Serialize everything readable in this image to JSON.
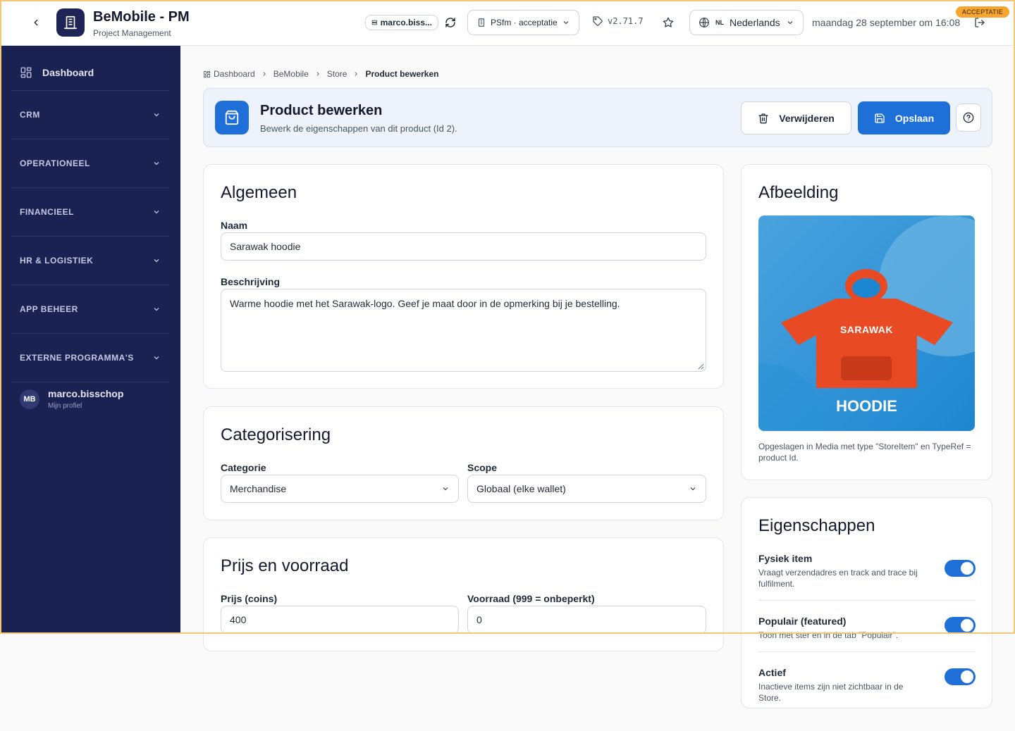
{
  "app": {
    "title": "BeMobile - PM",
    "subtitle": "Project Management"
  },
  "topbar": {
    "user_short": "marco.biss...",
    "environment": "PSfm · acceptatie",
    "version": "v2.71.7",
    "language_code": "NL",
    "language": "Nederlands",
    "datetime": "maandag 28 september om 16:08",
    "env_badge": "ACCEPTATIE"
  },
  "sidebar": {
    "dashboard": "Dashboard",
    "sections": [
      "CRM",
      "OPERATIONEEL",
      "FINANCIEEL",
      "HR & LOGISTIEK",
      "APP BEHEER",
      "EXTERNE PROGRAMMA'S"
    ],
    "profile": {
      "initials": "MB",
      "name": "marco.bisschop",
      "sub": "Mijn profiel"
    }
  },
  "breadcrumb": [
    "Dashboard",
    "BeMobile",
    "Store",
    "Product bewerken"
  ],
  "header": {
    "title": "Product bewerken",
    "subtitle": "Bewerk de eigenschappen van dit product (Id 2).",
    "delete_label": "Verwijderen",
    "save_label": "Opslaan"
  },
  "general": {
    "title": "Algemeen",
    "name_label": "Naam",
    "name_value": "Sarawak hoodie",
    "desc_label": "Beschrijving",
    "desc_value": "Warme hoodie met het Sarawak-logo. Geef je maat door in de opmerking bij je bestelling."
  },
  "categorization": {
    "title": "Categorisering",
    "category_label": "Categorie",
    "category_value": "Merchandise",
    "scope_label": "Scope",
    "scope_value": "Globaal (elke wallet)"
  },
  "pricing": {
    "title": "Prijs en voorraad",
    "price_label": "Prijs (coins)",
    "price_value": "400",
    "stock_label": "Voorraad (999 = onbeperkt)",
    "stock_value": "0"
  },
  "image": {
    "title": "Afbeelding",
    "brand": "SARAWAK",
    "product": "HOODIE",
    "caption": "Opgeslagen in Media met type \"StoreItem\" en TypeRef = product Id."
  },
  "properties": {
    "title": "Eigenschappen",
    "items": [
      {
        "title": "Fysiek item",
        "desc": "Vraagt verzendadres en track and trace bij fulfilment.",
        "enabled": true
      },
      {
        "title": "Populair (featured)",
        "desc": "Toon met ster en in de tab \"Populair\".",
        "enabled": true
      },
      {
        "title": "Actief",
        "desc": "Inactieve items zijn niet zichtbaar in de Store.",
        "enabled": true
      }
    ]
  },
  "colors": {
    "sidebar": "#1b2150",
    "primary": "#1f6fd8",
    "badge": "#f6a62e",
    "hoodie": "#e84b23"
  }
}
